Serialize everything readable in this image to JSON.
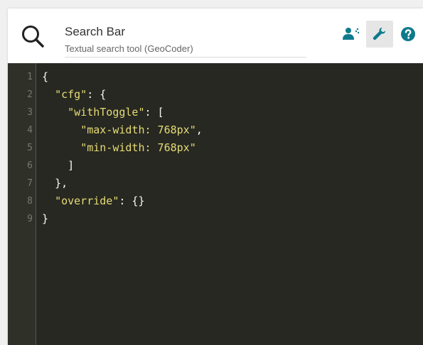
{
  "header": {
    "title": "Search Bar",
    "subtitle": "Textual search tool (GeoCoder)",
    "icon": "search-icon"
  },
  "toolbar": {
    "buttons": [
      {
        "icon": "user-settings-icon",
        "color": "#0f7a8c",
        "active": false
      },
      {
        "icon": "wrench-icon",
        "color": "#0f7a8c",
        "active": true
      },
      {
        "icon": "help-icon",
        "color": "#0f7a8c",
        "active": false
      }
    ]
  },
  "editor": {
    "theme_colors": {
      "background": "#272822",
      "string": "#e6db74",
      "text": "#f8f8f2",
      "gutter_text": "#777770"
    },
    "line_numbers": [
      "1",
      "2",
      "3",
      "4",
      "5",
      "6",
      "7",
      "8",
      "9"
    ],
    "lines": [
      {
        "indent": "",
        "key": "",
        "rest": "{"
      },
      {
        "indent": "  ",
        "key": "\"cfg\"",
        "rest": ": {"
      },
      {
        "indent": "    ",
        "key": "\"withToggle\"",
        "rest": ": ["
      },
      {
        "indent": "      ",
        "key": "\"max-width: 768px\"",
        "rest": ","
      },
      {
        "indent": "      ",
        "key": "\"min-width: 768px\"",
        "rest": ""
      },
      {
        "indent": "    ",
        "key": "",
        "rest": "]"
      },
      {
        "indent": "  ",
        "key": "",
        "rest": "},"
      },
      {
        "indent": "  ",
        "key": "\"override\"",
        "rest": ": {}"
      },
      {
        "indent": "",
        "key": "",
        "rest": "}"
      }
    ]
  }
}
